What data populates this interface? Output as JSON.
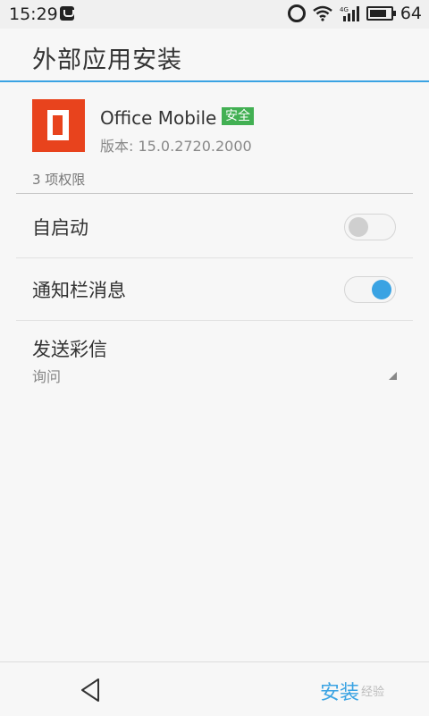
{
  "status_bar": {
    "time": "15:29",
    "signal_label": "4G",
    "battery_level": "64",
    "icons": [
      "notification-bag-icon",
      "alarm-icon",
      "wifi-icon",
      "signal-icon",
      "battery-icon"
    ]
  },
  "header": {
    "title": "外部应用安装"
  },
  "app": {
    "name": "Office Mobile",
    "badge": "安全",
    "version": "版本: 15.0.2720.2000",
    "icon": "office-icon",
    "brand_color": "#e8431d"
  },
  "permissions": {
    "count_label": "3 项权限",
    "items": [
      {
        "label": "自启动",
        "enabled": false
      },
      {
        "label": "通知栏消息",
        "enabled": true
      },
      {
        "label": "发送彩信",
        "value": "询问"
      }
    ]
  },
  "bottom_bar": {
    "back_icon": "back-triangle-icon",
    "install_label": "安装",
    "watermark": "经验"
  },
  "colors": {
    "accent": "#3aa3e3",
    "safe_badge": "#42b053"
  }
}
